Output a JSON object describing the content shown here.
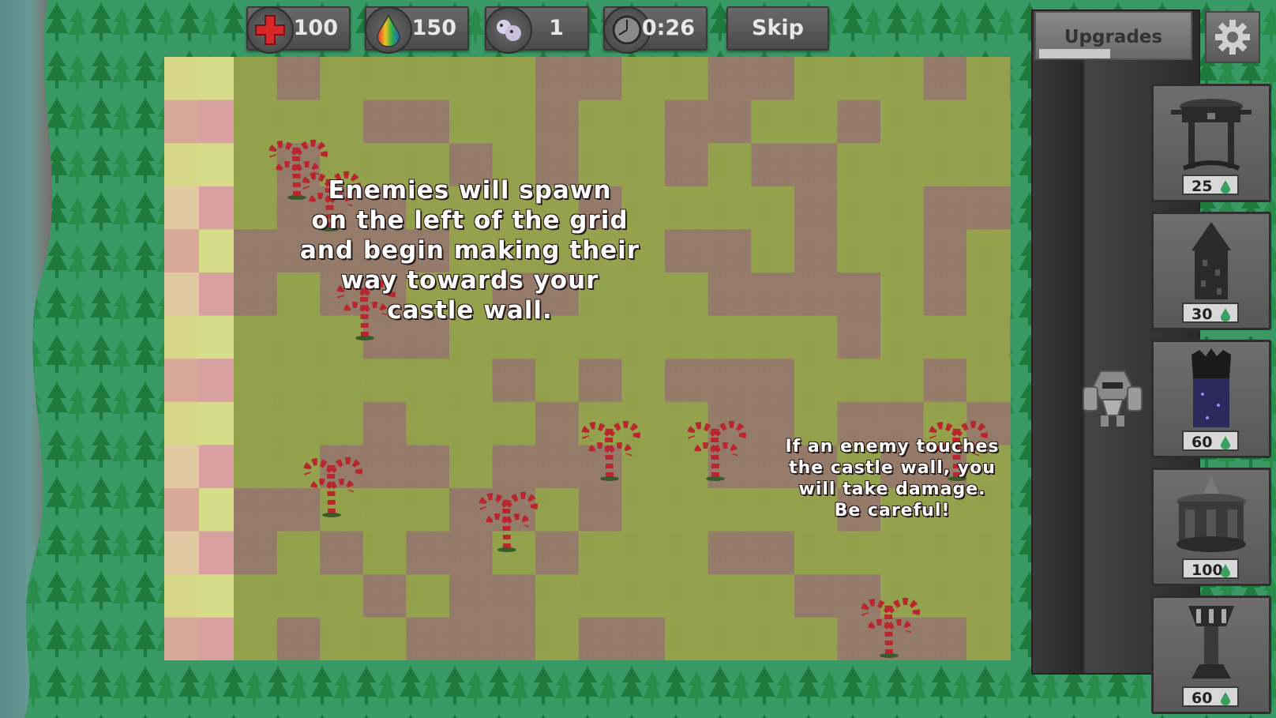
{
  "hud": {
    "health": "100",
    "mana": "150",
    "wave": "1",
    "timer": "0:26",
    "skip_label": "Skip"
  },
  "hud_icons": [
    "red-cross-health-icon",
    "rainbow-drop-mana-icon",
    "sheep-wave-icon",
    "clock-icon"
  ],
  "tutorial": {
    "text_1": "Enemies will spawn\non the left of the grid\nand begin making their\nway towards your\ncastle wall.",
    "text_2": "If an enemy touches\nthe castle wall, you\nwill take damage.\nBe careful!"
  },
  "sidebar": {
    "upgrades_label": "Upgrades",
    "settings_icon": "gear-icon",
    "towers": [
      {
        "id": "basic",
        "cost": "25"
      },
      {
        "id": "spire",
        "cost": "30"
      },
      {
        "id": "dark",
        "cost": "60"
      },
      {
        "id": "castle",
        "cost": "100"
      },
      {
        "id": "pillar",
        "cost": "60"
      }
    ]
  },
  "colors": {
    "grid_green": "#9aa24c",
    "grid_pink": "#9a7a6a",
    "candy_red": "#b8262e",
    "panel_gray": "#5e5e5e"
  }
}
